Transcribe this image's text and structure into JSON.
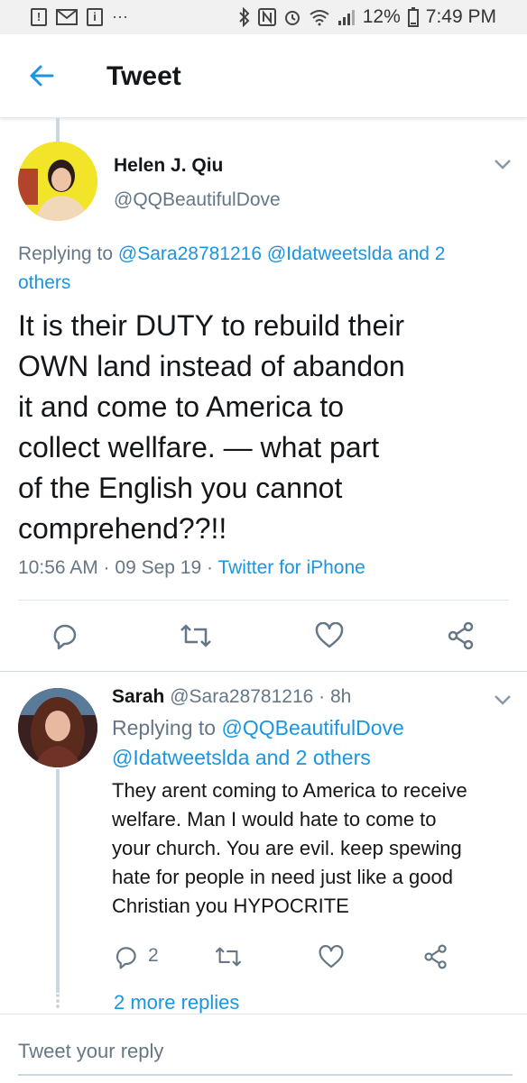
{
  "status_bar": {
    "battery": "12%",
    "time": "7:49 PM",
    "dots": "···"
  },
  "app_bar": {
    "title": "Tweet"
  },
  "main_tweet": {
    "name": "Helen J. Qiu",
    "handle": "@QQBeautifulDove",
    "replying_prefix": "Replying to",
    "replying_to": "@Sara28781216 @Idatweetslda and 2",
    "replying_to_line2": "others",
    "text_lines": [
      "It is their DUTY to rebuild their",
      "OWN land instead of abandon",
      "it and come to America to",
      "collect wellfare. — what part",
      "of the English you cannot",
      "comprehend??!!"
    ],
    "time": "10:56 AM · 09 Sep 19 ·",
    "source": "Twitter for iPhone"
  },
  "reply": {
    "name": "Sarah",
    "handle": "@Sara28781216 · 8h",
    "replying_prefix": "Replying to",
    "replying_to": "@QQBeautifulDove",
    "replying_to_line2": "@Idatweetslda and 2 others",
    "text_lines": [
      "They arent coming to America to receive",
      "welfare. Man I would hate to come to",
      "your church. You are evil. keep spewing",
      "hate for people in need just like a good",
      "Christian you HYPOCRITE"
    ],
    "reply_count": "2",
    "more_replies": "2 more replies"
  },
  "compose": {
    "placeholder": "Tweet your reply"
  },
  "colors": {
    "accent": "#1b95e0",
    "muted": "#657786",
    "text": "#14171a"
  }
}
